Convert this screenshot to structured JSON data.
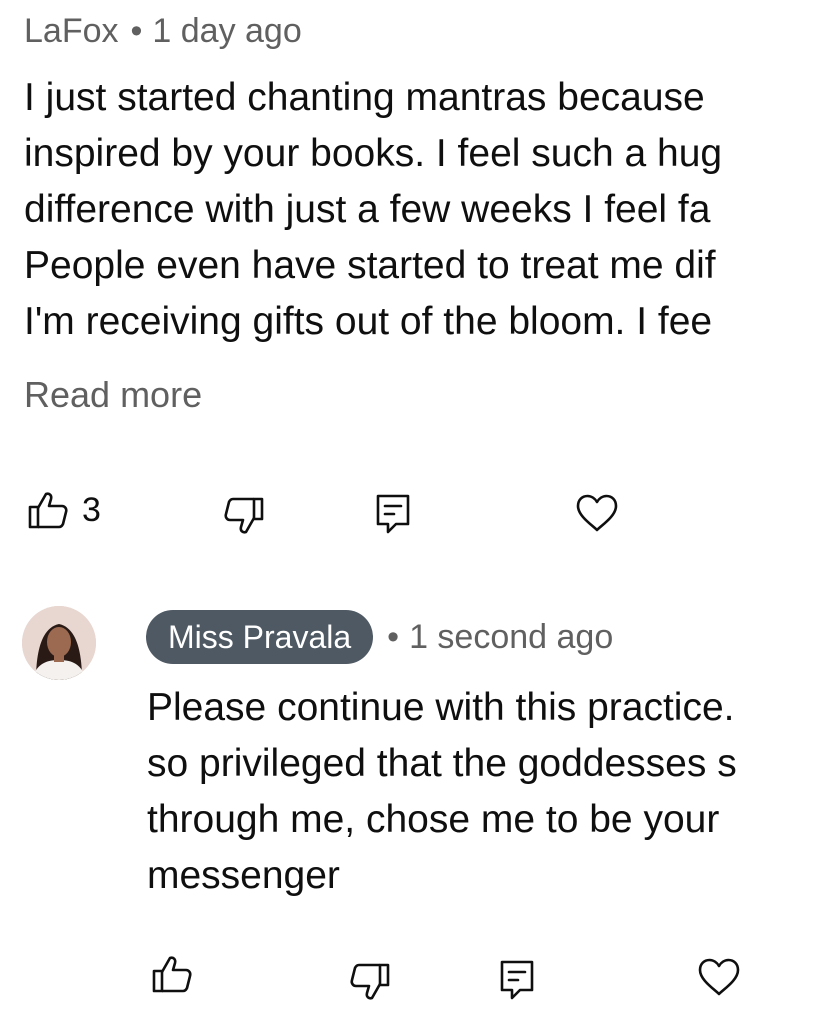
{
  "comment": {
    "author": "LaFox",
    "separator": "•",
    "time": "1 day ago",
    "lines": [
      "I just started chanting mantras because",
      "inspired by your books. I feel such a hug",
      "difference with just a few weeks I feel fa",
      "People even have started to treat me dif",
      "I'm receiving gifts out of the bloom. I fee"
    ],
    "read_more": "Read more",
    "like_count": "3",
    "icons": [
      "thumbs-up-icon",
      "thumbs-down-icon",
      "reply-icon",
      "heart-icon"
    ]
  },
  "reply": {
    "author": "Miss Pravala",
    "separator": "•",
    "time": "1 second ago",
    "lines": [
      "Please continue with this practice.",
      "so privileged that the goddesses s",
      "through me, chose me to be your",
      "messenger"
    ],
    "icons": [
      "thumbs-up-icon",
      "thumbs-down-icon",
      "reply-icon",
      "heart-icon"
    ]
  },
  "colors": {
    "text": "#0f0f0f",
    "meta": "#606060",
    "author_chip_bg": "#4e5964",
    "author_chip_text": "#ffffff"
  }
}
